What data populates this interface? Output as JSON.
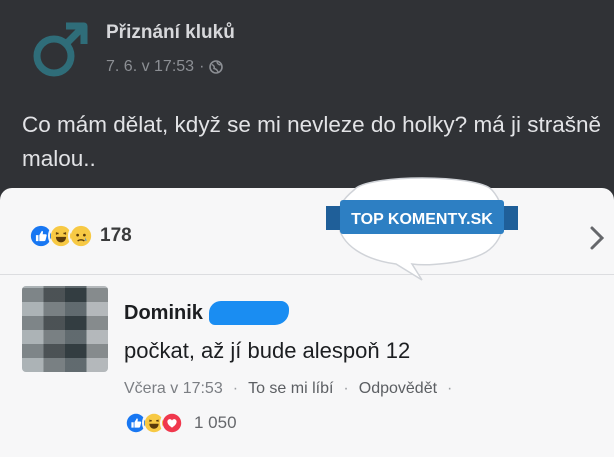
{
  "post": {
    "page_name": "Přiznání kluků",
    "timestamp": "7. 6. v 17:53",
    "separator": "·",
    "text": "Co mám dělat, když se mi nevleze do holky? má ji strašně malou..",
    "logo_icon": "male-symbol-icon",
    "privacy_icon": "globe-icon"
  },
  "reactions": {
    "icons": [
      "like-icon",
      "haha-icon",
      "sad-icon"
    ],
    "count": "178"
  },
  "comment": {
    "author": "Dominik",
    "text": "počkat, až jí bude alespoň 12",
    "time": "Včera v 17:53",
    "like_label": "To se mi líbí",
    "reply_label": "Odpovědět",
    "separator": "·",
    "reaction_icons": [
      "like-icon",
      "haha-icon",
      "love-icon"
    ],
    "reaction_count": "1 050"
  },
  "watermark": {
    "text": "TOP KOMENTY.SK"
  },
  "colors": {
    "like_blue": "#1877f2",
    "haha_yellow": "#f7c944",
    "love_red": "#f0384d",
    "badge_blue": "#2d7fc3"
  }
}
